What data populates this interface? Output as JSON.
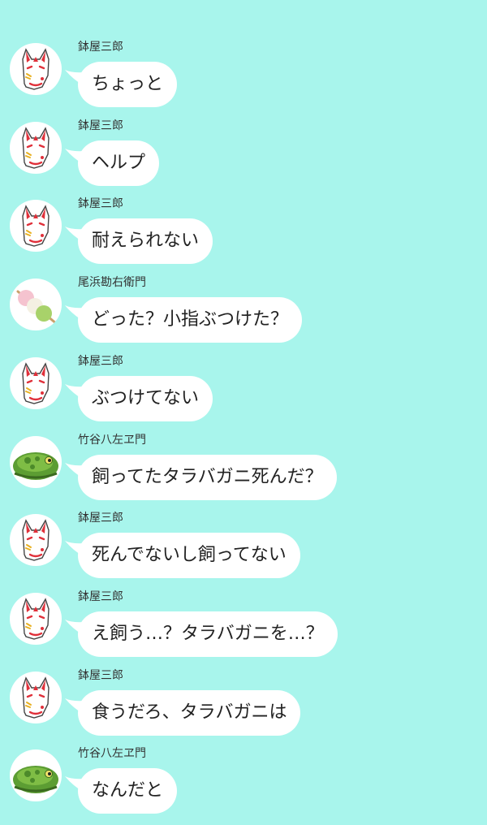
{
  "colors": {
    "background": "#a8f5ec",
    "bubble": "#ffffff",
    "text": "#222222"
  },
  "messages": [
    {
      "sender": "鉢屋三郎",
      "avatar": "fox-mask-icon",
      "text": "ちょっと"
    },
    {
      "sender": "鉢屋三郎",
      "avatar": "fox-mask-icon",
      "text": "ヘルプ"
    },
    {
      "sender": "鉢屋三郎",
      "avatar": "fox-mask-icon",
      "text": "耐えられない"
    },
    {
      "sender": "尾浜勘右衛門",
      "avatar": "dango-icon",
      "text": "どった？小指ぶつけた？"
    },
    {
      "sender": "鉢屋三郎",
      "avatar": "fox-mask-icon",
      "text": "ぶつけてない"
    },
    {
      "sender": "竹谷八左ヱ門",
      "avatar": "toad-icon",
      "text": "飼ってたタラバガニ死んだ？"
    },
    {
      "sender": "鉢屋三郎",
      "avatar": "fox-mask-icon",
      "text": "死んでないし飼ってない"
    },
    {
      "sender": "鉢屋三郎",
      "avatar": "fox-mask-icon",
      "text": "え飼う…？タラバガニを…？"
    },
    {
      "sender": "鉢屋三郎",
      "avatar": "fox-mask-icon",
      "text": "食うだろ、タラバガニは"
    },
    {
      "sender": "竹谷八左ヱ門",
      "avatar": "toad-icon",
      "text": "なんだと"
    }
  ]
}
